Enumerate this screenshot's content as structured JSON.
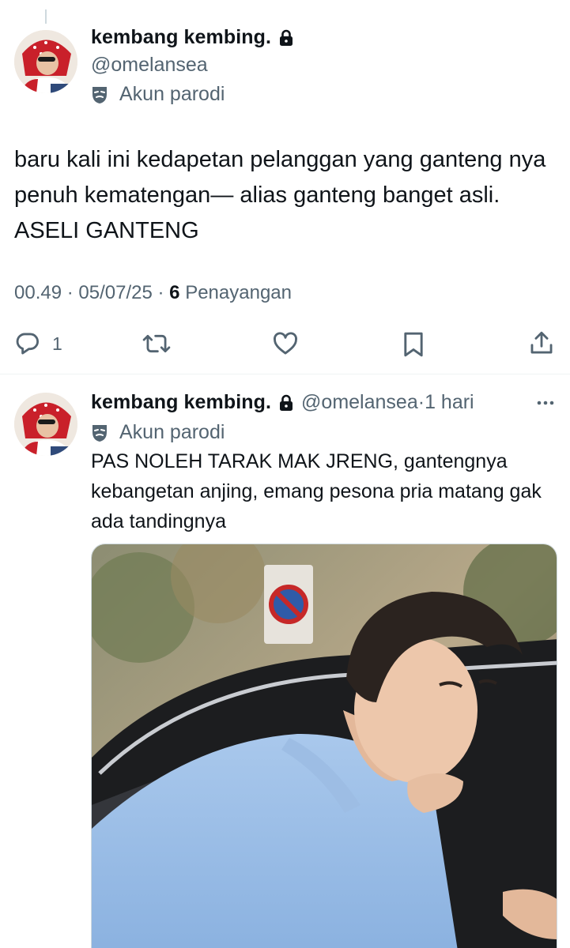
{
  "main_tweet": {
    "display_name": "kembang kembing.",
    "handle": "@omelansea",
    "account_label": "Akun parodi",
    "text": "baru kali ini kedapetan pelanggan yang ganteng nya penuh kematengan— alias ganteng banget asli. ASELI GANTENG",
    "time": "00.49",
    "date": "05/07/25",
    "views": "6",
    "views_label": "Penayangan",
    "actions": {
      "reply_count": "1",
      "reply_icon": "reply-icon",
      "retweet_icon": "retweet-icon",
      "like_icon": "heart-icon",
      "bookmark_icon": "bookmark-icon",
      "share_icon": "share-icon"
    }
  },
  "quoted_tweet": {
    "display_name": "kembang kembing.",
    "handle": "@omelansea",
    "time_ago": "1 hari",
    "account_label": "Akun parodi",
    "text": "PAS NOLEH TARAK MAK JRENG, gantengnya kebangetan anjing, emang pesona pria matang gak ada tandingnya",
    "media_alt": "photo"
  },
  "colors": {
    "primary_text": "#0f1419",
    "secondary_text": "#536471",
    "divider": "#eff3f4",
    "avatar_accent": "#d0212b"
  }
}
